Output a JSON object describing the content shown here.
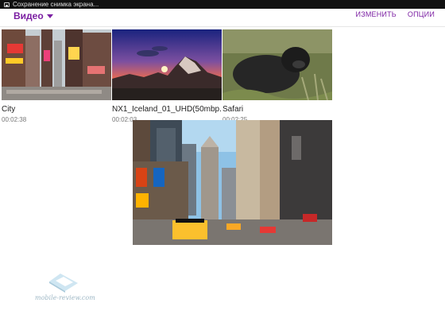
{
  "status_bar": {
    "notification": "Сохранение снимка экрана..."
  },
  "header": {
    "title": "Видео",
    "actions": {
      "edit": "ИЗМЕНИТЬ",
      "options": "ОПЦИИ"
    }
  },
  "videos": [
    {
      "name": "City",
      "duration": "00:02:38"
    },
    {
      "name": "NX1_Iceland_01_UHD(50mbp...",
      "duration": "00:02:03"
    },
    {
      "name": "Safari",
      "duration": "00:02:25"
    }
  ],
  "watermark": {
    "text": "mobile-review.com"
  },
  "colors": {
    "accent": "#7b1fa2",
    "status_bar": "#111111"
  }
}
